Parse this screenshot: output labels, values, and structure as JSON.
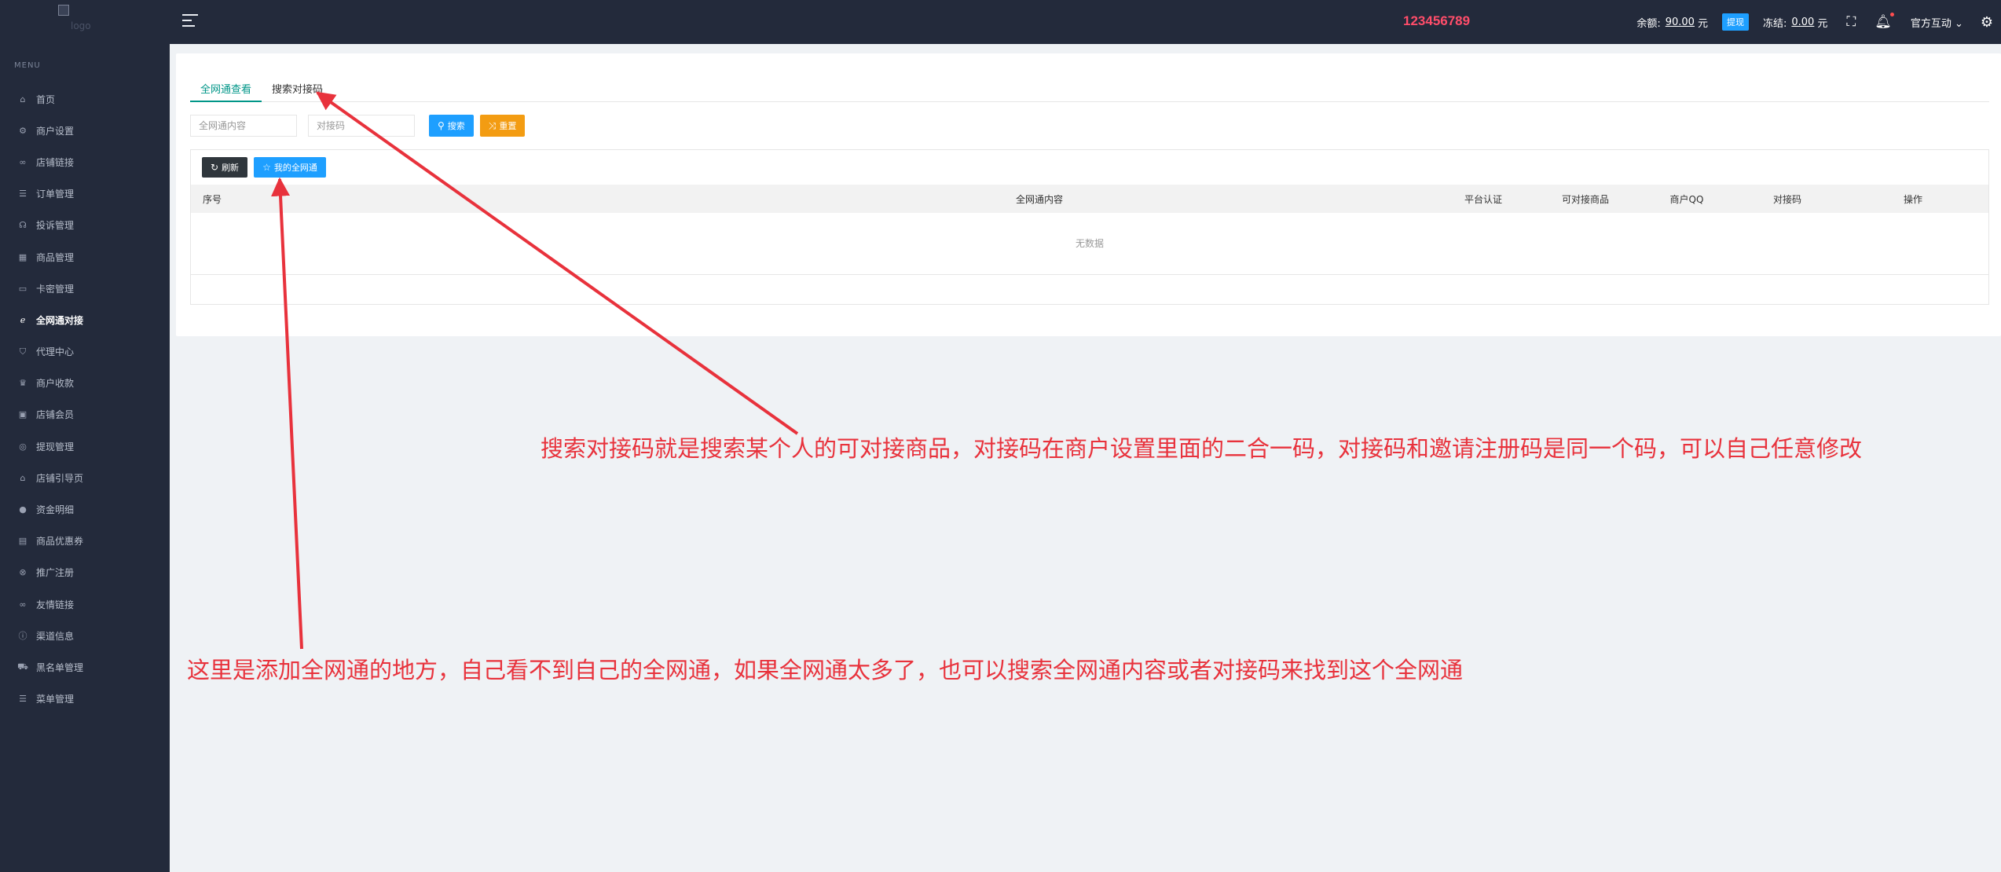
{
  "sidebar": {
    "menu_title": "MENU",
    "logo_alt": "logo",
    "items": [
      {
        "label": "首页",
        "icon": "home-icon",
        "glyph": "⌂"
      },
      {
        "label": "商户设置",
        "icon": "gear-icon",
        "glyph": "⚙"
      },
      {
        "label": "店铺链接",
        "icon": "link-icon",
        "glyph": "∞"
      },
      {
        "label": "订单管理",
        "icon": "list-icon",
        "glyph": "☰"
      },
      {
        "label": "投诉管理",
        "icon": "headset-icon",
        "glyph": "☊"
      },
      {
        "label": "商品管理",
        "icon": "grid-icon",
        "glyph": "▦"
      },
      {
        "label": "卡密管理",
        "icon": "card-icon",
        "glyph": "▭"
      },
      {
        "label": "全网通对接",
        "icon": "ie-icon",
        "glyph": "ℯ"
      },
      {
        "label": "代理中心",
        "icon": "shield-icon",
        "glyph": "⛉"
      },
      {
        "label": "商户收款",
        "icon": "crown-icon",
        "glyph": "♛"
      },
      {
        "label": "店铺会员",
        "icon": "member-icon",
        "glyph": "▣"
      },
      {
        "label": "提现管理",
        "icon": "target-icon",
        "glyph": "◎"
      },
      {
        "label": "店铺引导页",
        "icon": "home-icon",
        "glyph": "⌂"
      },
      {
        "label": "资金明细",
        "icon": "coin-icon",
        "glyph": "●"
      },
      {
        "label": "商品优惠券",
        "icon": "coupon-icon",
        "glyph": "▤"
      },
      {
        "label": "推广注册",
        "icon": "share-icon",
        "glyph": "⊗"
      },
      {
        "label": "友情链接",
        "icon": "link-icon",
        "glyph": "∞"
      },
      {
        "label": "渠道信息",
        "icon": "info-icon",
        "glyph": "ⓘ"
      },
      {
        "label": "黑名单管理",
        "icon": "car-icon",
        "glyph": "⛟"
      },
      {
        "label": "菜单管理",
        "icon": "menu-icon",
        "glyph": "☰"
      }
    ],
    "active_index": 7
  },
  "header": {
    "brand_code": "123456789",
    "balance_label": "余额:",
    "balance_value": "90.00",
    "balance_unit": "元",
    "withdraw_label": "提现",
    "frozen_label": "冻结:",
    "frozen_value": "0.00",
    "frozen_unit": "元",
    "user_menu": "官方互动 ⌄"
  },
  "tabs": [
    {
      "label": "全网通查看",
      "active": true
    },
    {
      "label": "搜索对接码",
      "active": false
    }
  ],
  "search": {
    "content_placeholder": "全网通内容",
    "code_placeholder": "对接码",
    "search_label": "搜索",
    "reset_label": "重置"
  },
  "toolbar": {
    "refresh_label": "刷新",
    "my_network_label": "我的全网通"
  },
  "table": {
    "columns": [
      "序号",
      "全网通内容",
      "平台认证",
      "可对接商品",
      "商户QQ",
      "对接码",
      "操作"
    ],
    "empty_text": "无数据"
  },
  "annotations": {
    "note_1": "搜索对接码就是搜索某个人的可对接商品，对接码在商户设置里面的二合一码，对接码和邀请注册码是同一个码，可以自己任意修改",
    "note_2": "这里是添加全网通的地方，自己看不到自己的全网通，如果全网通太多了，也可以搜索全网通内容或者对接码来找到这个全网通",
    "arrow_color": "#e8323c"
  }
}
